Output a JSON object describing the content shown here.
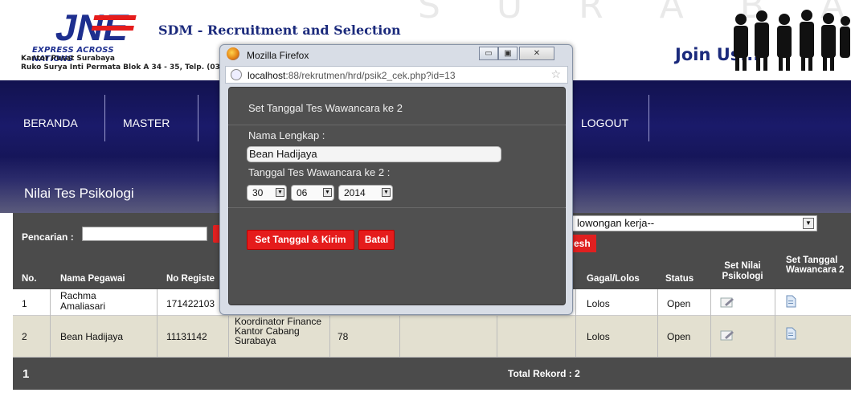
{
  "header": {
    "brand": "JNE",
    "brand_tagline": "EXPRESS ACROSS NATIONS",
    "office_name": "Kantor Pusat Surabaya",
    "office_address": "Ruko Surya Inti Permata Blok A 34 - 35, Telp. (03",
    "app_title": "SDM - Recruitment and Selection",
    "watermark": "S U R A B A Y A",
    "join_us": "Join Us...",
    "colors": {
      "brand_blue": "#1b2a7c",
      "brand_red": "#e51c1c"
    }
  },
  "nav": {
    "items": [
      {
        "label": "BERANDA"
      },
      {
        "label": "MASTER"
      },
      {
        "label": "LOGOUT"
      }
    ]
  },
  "section_title": "Nilai Tes Psikologi",
  "search": {
    "label": "Pencarian :",
    "value": "",
    "vacancy_filter": "lowongan kerja--",
    "refresh_label": "esh"
  },
  "table": {
    "headers": {
      "no": "No.",
      "nama": "Nama Pegawai",
      "noreg": "No Registe",
      "gagal": "Gagal/Lolos",
      "status": "Status",
      "set_nilai": "Set Nilai Psikologi",
      "set_tanggal": "Set Tanggal Wawancara 2"
    },
    "rows": [
      {
        "no": "1",
        "nama": "Rachma Amaliasari",
        "noreg": "171422103",
        "jabatan": "",
        "nilai": "",
        "gagal": "Lolos",
        "status": "Open",
        "edit_icon": "edit-icon",
        "doc_icon": "document-icon"
      },
      {
        "no": "2",
        "nama": "Bean Hadijaya",
        "noreg": "11131142",
        "jabatan": "Koordinator Finance Kantor Cabang Surabaya",
        "nilai": "78",
        "gagal": "Lolos",
        "status": "Open",
        "edit_icon": "edit-icon",
        "doc_icon": "document-icon"
      }
    ],
    "footer": {
      "page": "1",
      "total": "Total Rekord : 2"
    }
  },
  "popup": {
    "window_title": "Mozilla Firefox",
    "url_host": "localhost",
    "url_rest": ":88/rekrutmen/hrd/psik2_cek.php?id=13",
    "dialog_title": "Set Tanggal Tes Wawancara ke 2",
    "name_label": "Nama Lengkap :",
    "name_value": "Bean Hadijaya",
    "date_label": "Tanggal Tes Wawancara ke 2 :",
    "day": "30",
    "month": "06",
    "year": "2014",
    "submit_label": "Set Tanggal & Kirim",
    "cancel_label": "Batal",
    "window_buttons": {
      "minimize": "▭",
      "maximize": "▣",
      "close": "✕"
    }
  }
}
